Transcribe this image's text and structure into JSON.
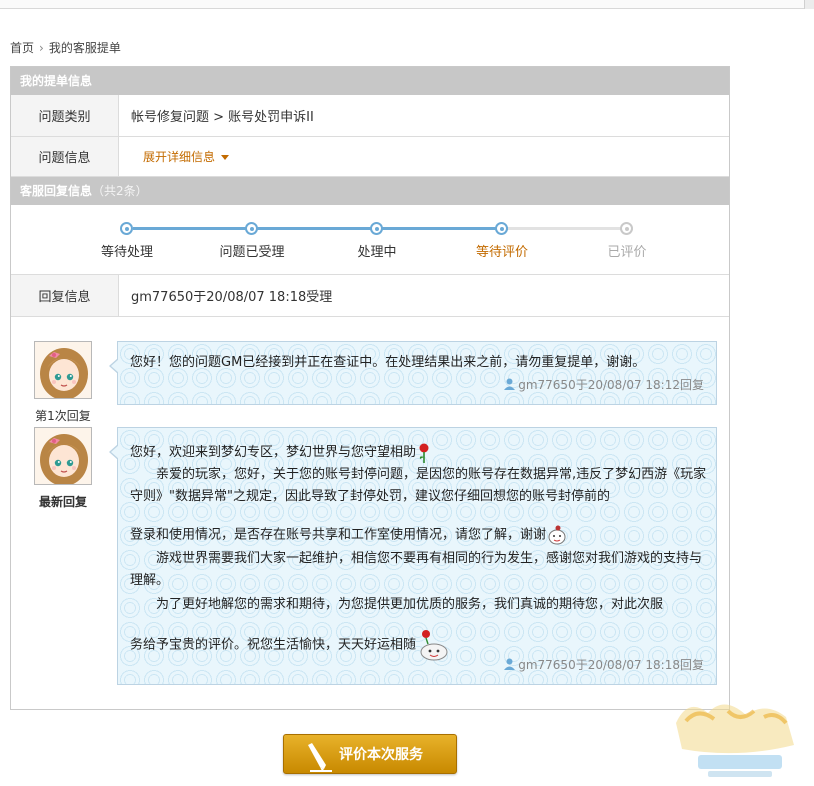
{
  "breadcrumb": {
    "home": "首页",
    "current": "我的客服提单"
  },
  "ticket": {
    "section_title": "我的提单信息",
    "category_label": "问题类别",
    "category_value": "帐号修复问题 > 账号处罚申诉II",
    "info_label": "问题信息",
    "expand_label": "展开详细信息"
  },
  "reply": {
    "section_title": "客服回复信息",
    "section_count": "（共2条）",
    "steps": [
      {
        "label": "等待处理",
        "state": "done"
      },
      {
        "label": "问题已受理",
        "state": "done"
      },
      {
        "label": "处理中",
        "state": "done"
      },
      {
        "label": "等待评价",
        "state": "current"
      },
      {
        "label": "已评价",
        "state": "pending"
      }
    ],
    "info_label": "回复信息",
    "info_value": "gm77650于20/08/07 18:18受理"
  },
  "messages": [
    {
      "avatar_label": "第1次回复",
      "text": "您好！您的问题GM已经接到并正在查证中。在处理结果出来之前，请勿重复提单，谢谢。",
      "meta": "gm77650于20/08/07 18:12回复"
    },
    {
      "avatar_label": "最新回复",
      "greeting": "您好，欢迎来到梦幻专区，梦幻世界与您守望相助",
      "para1": "亲爱的玩家，您好，关于您的账号封停问题，是因您的账号存在数据异常,违反了梦幻西游《玩家守则》\"数据异常\"之规定，因此导致了封停处罚，建议您仔细回想您的账号封停前的",
      "para1b": "登录和使用情况，是否存在账号共享和工作室使用情况，请您了解，谢谢",
      "para2": "游戏世界需要我们大家一起维护，相信您不要再有相同的行为发生，感谢您对我们游戏的支持与理解。",
      "para3": "为了更好地解您的需求和期待，为您提供更加优质的服务，我们真诚的期待您，对此次服",
      "para3b": "务给予宝贵的评价。祝您生活愉快，天天好运相随",
      "meta": "gm77650于20/08/07 18:18回复"
    }
  ],
  "action": {
    "rate_label": "评价本次服务"
  },
  "colors": {
    "accent": "#c36b00",
    "progress": "#6aa9d6",
    "header": "#c7c7c7",
    "button": "#d99e10"
  }
}
